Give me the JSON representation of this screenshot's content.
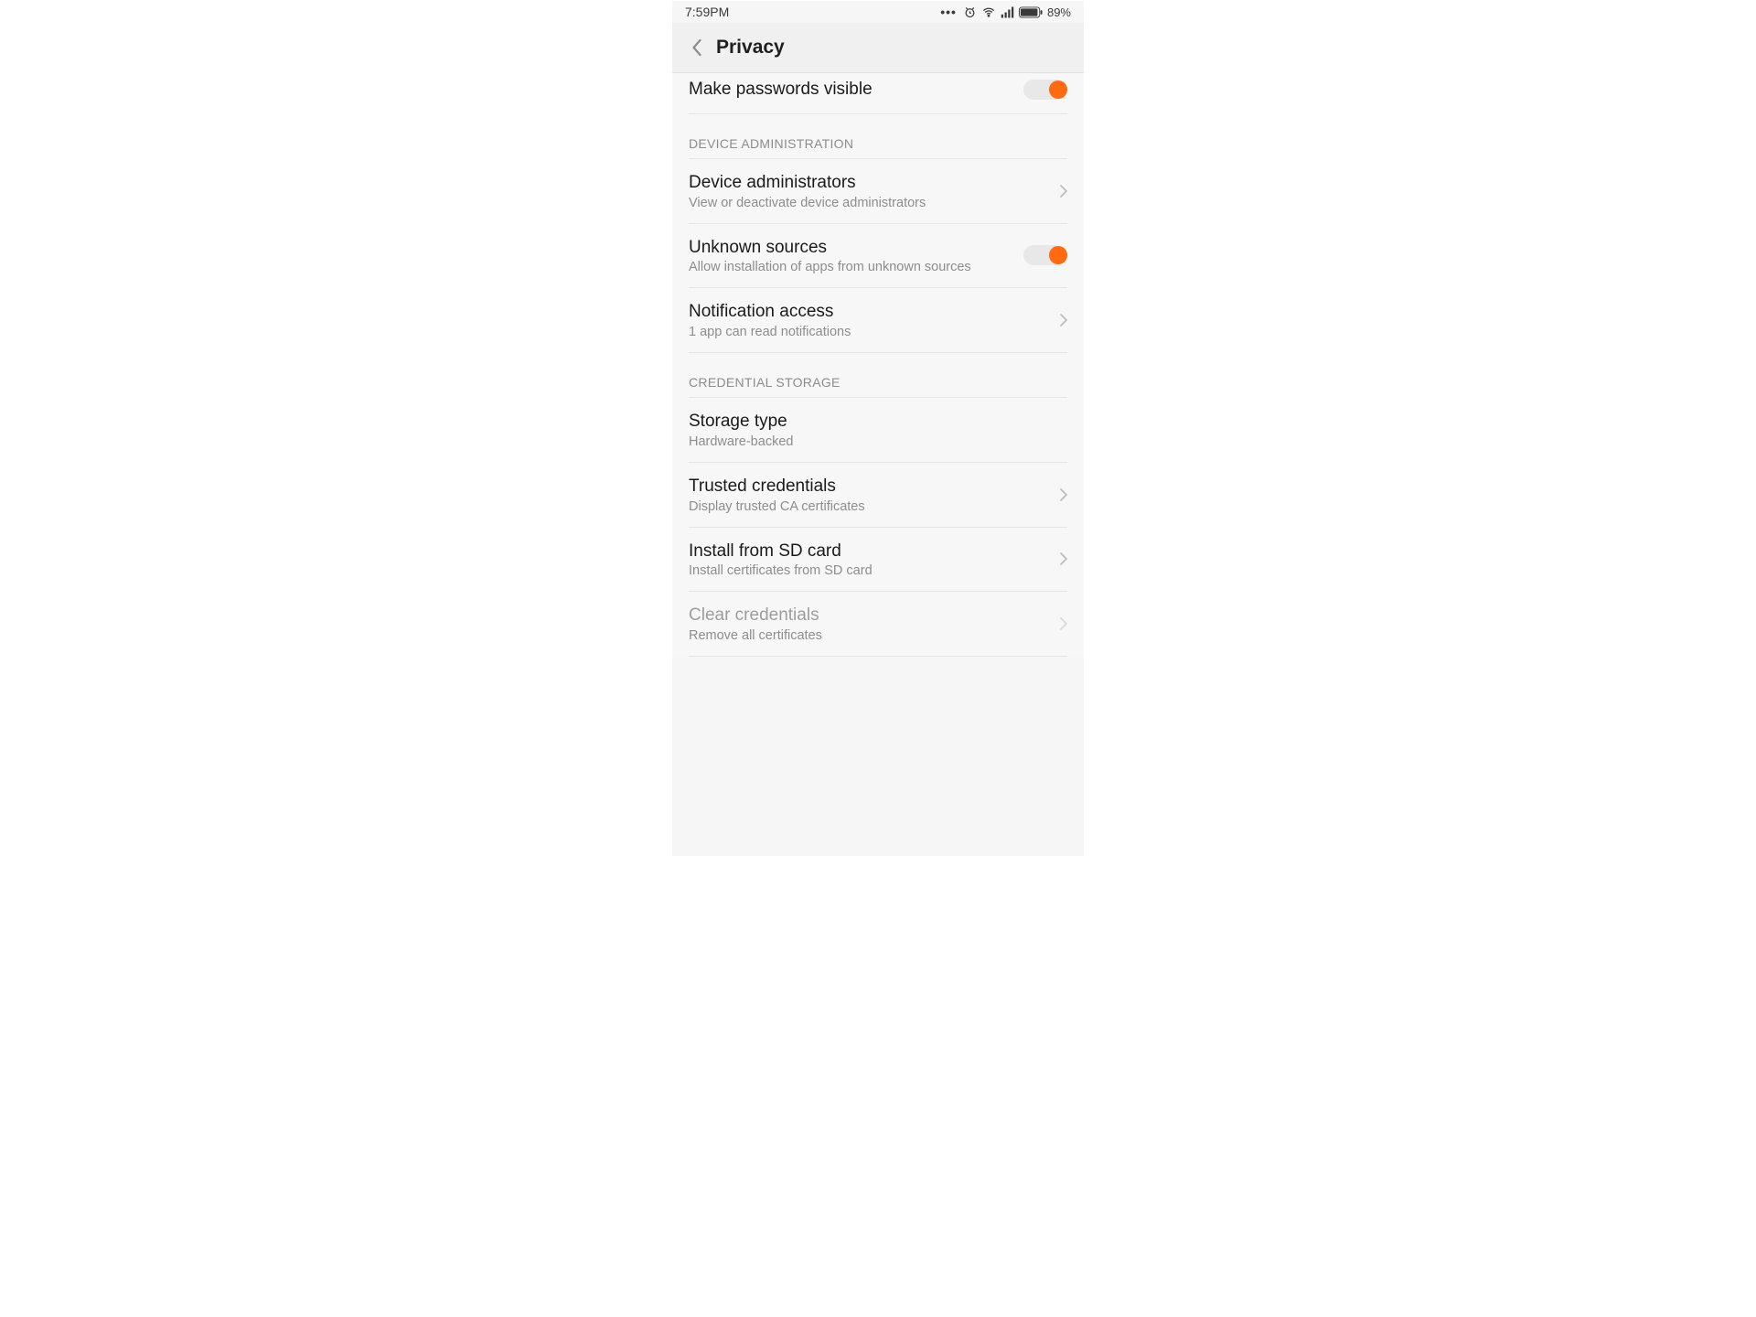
{
  "status": {
    "time": "7:59PM",
    "battery": "89%"
  },
  "title": "Privacy",
  "row_passwords": {
    "title": "Make passwords visible",
    "toggle": true
  },
  "section_admin": "DEVICE ADMINISTRATION",
  "row_device_admins": {
    "title": "Device administrators",
    "sub": "View or deactivate device administrators"
  },
  "row_unknown_sources": {
    "title": "Unknown sources",
    "sub": "Allow installation of apps from unknown sources",
    "toggle": true
  },
  "row_notification_access": {
    "title": "Notification access",
    "sub": "1 app can read notifications"
  },
  "section_credential": "CREDENTIAL STORAGE",
  "row_storage_type": {
    "title": "Storage type",
    "sub": "Hardware-backed"
  },
  "row_trusted_credentials": {
    "title": "Trusted credentials",
    "sub": "Display trusted CA certificates"
  },
  "row_install_sd": {
    "title": "Install from SD card",
    "sub": "Install certificates from SD card"
  },
  "row_clear_credentials": {
    "title": "Clear credentials",
    "sub": "Remove all certificates"
  }
}
